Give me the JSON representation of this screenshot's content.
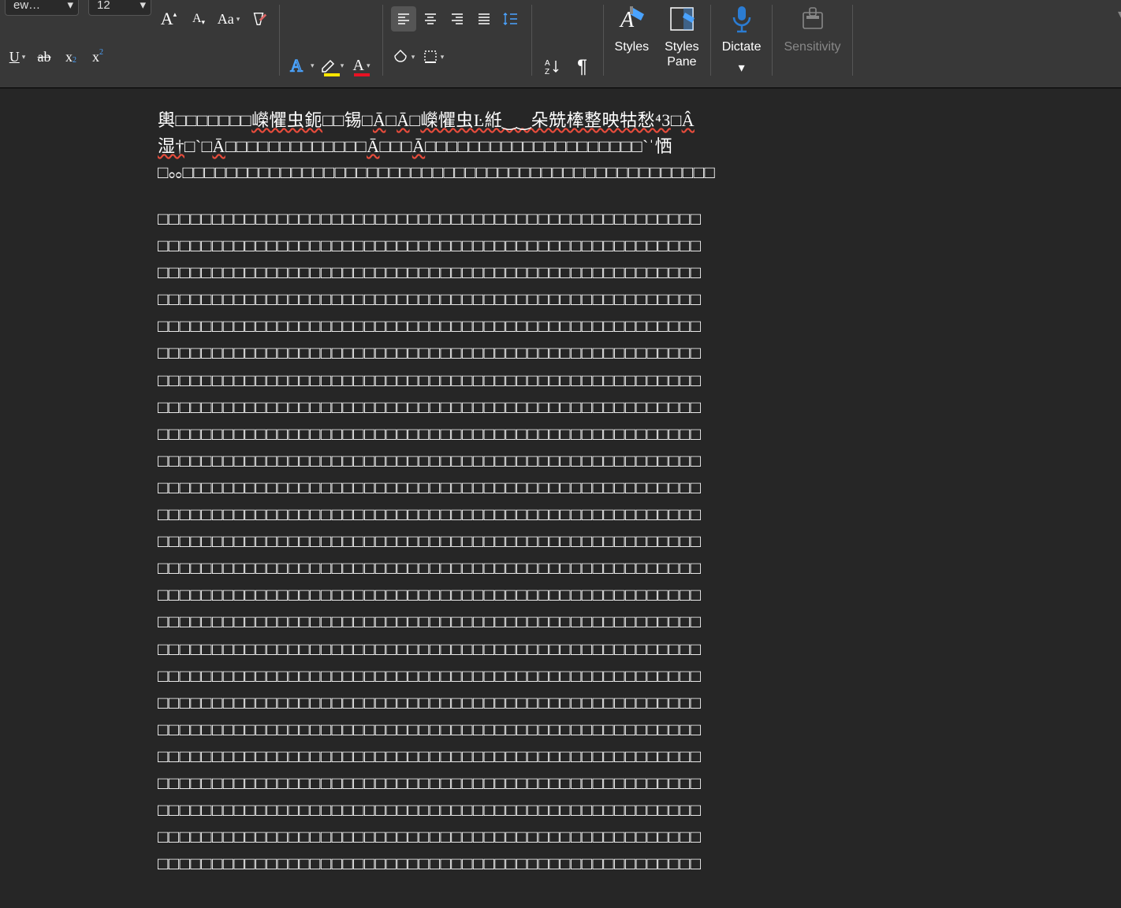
{
  "ribbon": {
    "font_name": "ew…",
    "font_size": "12",
    "styles_label": "Styles",
    "styles_pane_label": "Styles\nPane",
    "dictate_label": "Dictate",
    "sensitivity_label": "Sensitivity"
  },
  "document": {
    "line1_a": "輿",
    "line1_tofu1": "□□□□□□□",
    "line1_b": "嶸懼虫鈪",
    "line1_tofu2": "□□",
    "line1_c": "锡",
    "line1_tofu3": "□",
    "line1_d": "Ā",
    "line1_tofu4": "□",
    "line1_e": "Ā",
    "line1_tofu5": "□",
    "line1_f": "嶸懼虫Ŀ絍‿‿朵兟㯠整映牯愁⁴3",
    "line1_tofu6": "□",
    "line1_g": "Â",
    "line2_a": "湿†",
    "line2_tofu1": "□`□",
    "line2_b": "Ā",
    "line2_tofu2": "□□□□□□□□□□□□□",
    "line2_c": "Ā",
    "line2_tofu3": "□□□",
    "line2_d": "Ā",
    "line2_tofu4": "□□□□□□□□□□□□□□□□□□□□`ˈ恓",
    "line3_tofu1": "□",
    "line3_a": "ೲ",
    "line3_tofu2": "□□□□□□□□□□□□□□□□□□□□□□□□□□□□□□□□□□□□□□□□□□□□□□□□□",
    "tofu_rows": 25,
    "tofu_per_row": 50,
    "tofu_char": "□"
  }
}
